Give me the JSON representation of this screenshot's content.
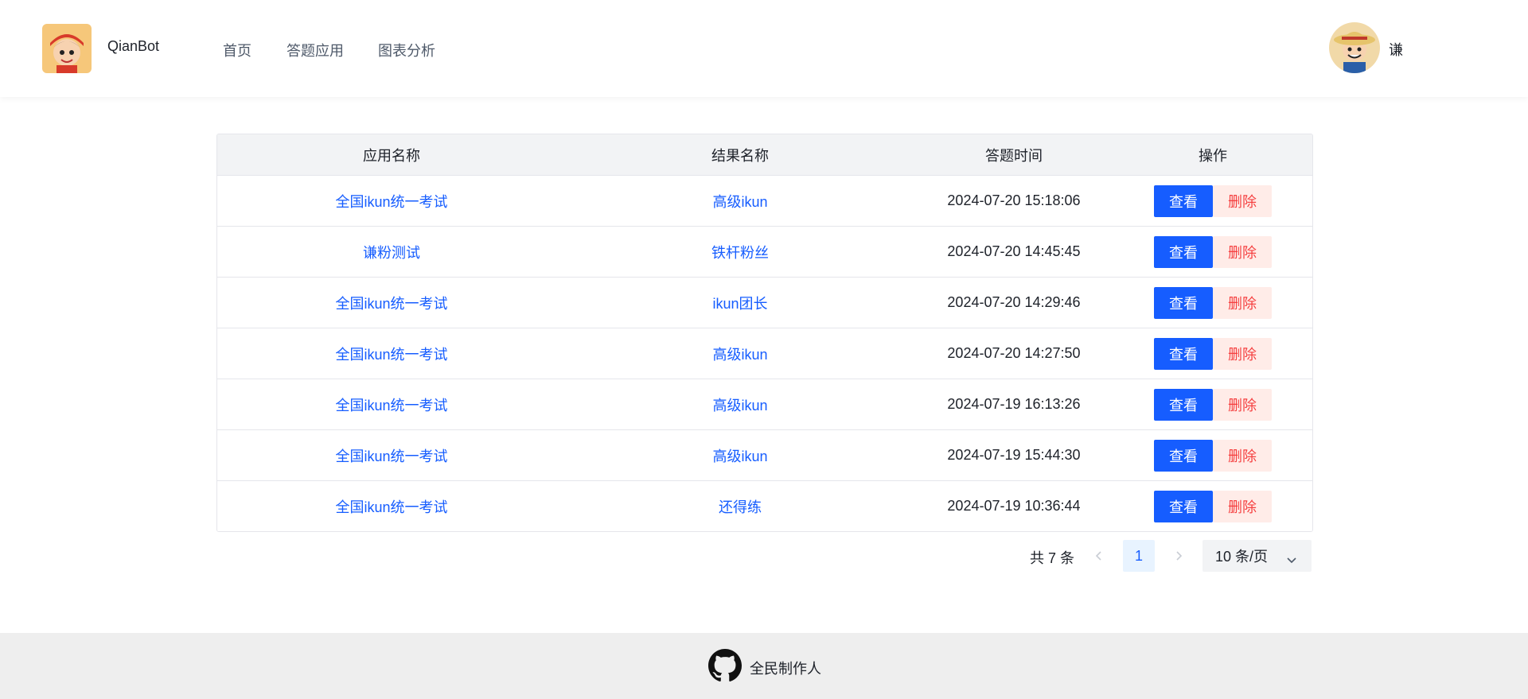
{
  "header": {
    "brand": "QianBot",
    "nav": [
      "首页",
      "答题应用",
      "图表分析"
    ],
    "username": "谦"
  },
  "table": {
    "columns": [
      "应用名称",
      "结果名称",
      "答题时间",
      "操作"
    ],
    "view_label": "查看",
    "delete_label": "删除",
    "rows": [
      {
        "app": "全国ikun统一考试",
        "result": "高级ikun",
        "time": "2024-07-20 15:18:06"
      },
      {
        "app": "谦粉测试",
        "result": "铁杆粉丝",
        "time": "2024-07-20 14:45:45"
      },
      {
        "app": "全国ikun统一考试",
        "result": "ikun团长",
        "time": "2024-07-20 14:29:46"
      },
      {
        "app": "全国ikun统一考试",
        "result": "高级ikun",
        "time": "2024-07-20 14:27:50"
      },
      {
        "app": "全国ikun统一考试",
        "result": "高级ikun",
        "time": "2024-07-19 16:13:26"
      },
      {
        "app": "全国ikun统一考试",
        "result": "高级ikun",
        "time": "2024-07-19 15:44:30"
      },
      {
        "app": "全国ikun统一考试",
        "result": "还得练",
        "time": "2024-07-19 10:36:44"
      }
    ]
  },
  "pagination": {
    "total": "共 7 条",
    "current": "1",
    "page_size": "10 条/页"
  },
  "footer": {
    "text": "全民制作人"
  },
  "colors": {
    "primary": "#165dff",
    "danger": "#f53f3f",
    "danger_bg": "#ffece8",
    "header_bg": "#f2f3f5",
    "footer_bg": "#eeeeee"
  }
}
